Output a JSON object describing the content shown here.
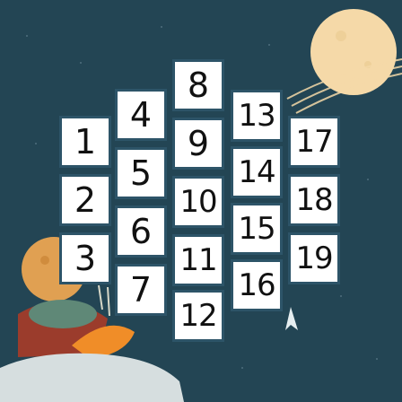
{
  "colors": {
    "background": "#234554",
    "tile": "#ffffff",
    "tile_border": "#2d5468",
    "moon": "#f5d9a8"
  },
  "puzzle": {
    "tiles": [
      {
        "label": "1"
      },
      {
        "label": "2"
      },
      {
        "label": "3"
      },
      {
        "label": "4"
      },
      {
        "label": "5"
      },
      {
        "label": "6"
      },
      {
        "label": "7"
      },
      {
        "label": "8"
      },
      {
        "label": "9"
      },
      {
        "label": "10"
      },
      {
        "label": "11"
      },
      {
        "label": "12"
      },
      {
        "label": "13"
      },
      {
        "label": "14"
      },
      {
        "label": "15"
      },
      {
        "label": "16"
      },
      {
        "label": "17"
      },
      {
        "label": "18"
      },
      {
        "label": "19"
      }
    ]
  },
  "icons": [
    "moon-icon",
    "wind-streaks-icon",
    "planet-icon",
    "fox-creature-icon",
    "small-rocket-icon"
  ]
}
